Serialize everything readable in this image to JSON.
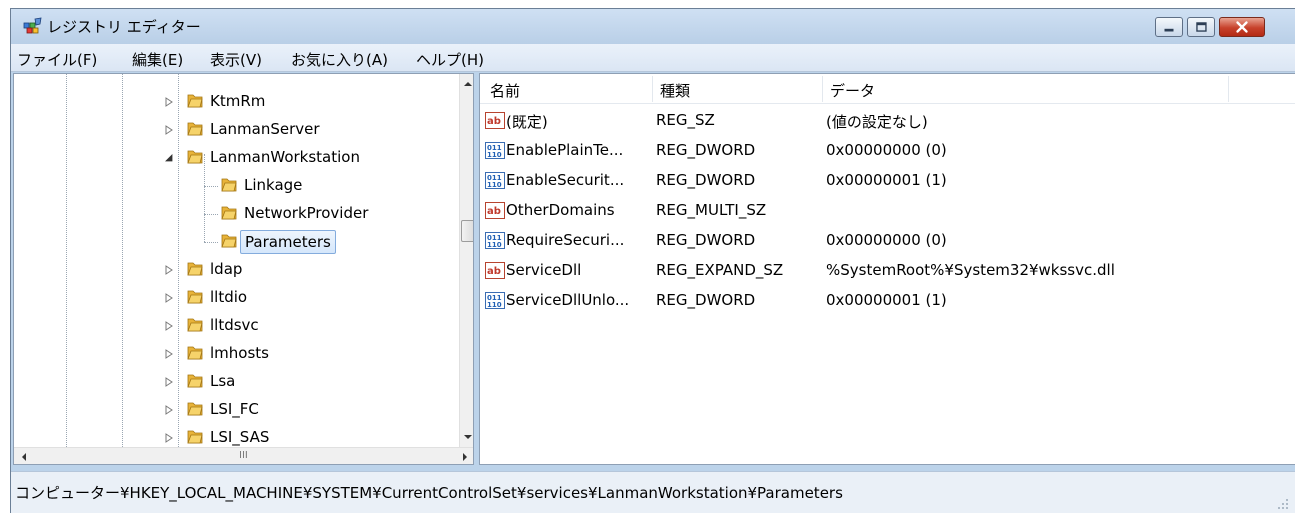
{
  "window": {
    "title": "レジストリ エディター"
  },
  "menu": {
    "items": [
      {
        "label": "ファイル(F)"
      },
      {
        "label": "編集(E)"
      },
      {
        "label": "表示(V)"
      },
      {
        "label": "お気に入り(A)"
      },
      {
        "label": "ヘルプ(H)"
      }
    ]
  },
  "tree": {
    "nodes": [
      {
        "label": "KtmRm",
        "expander": "collapsed",
        "icon": "folder-icon"
      },
      {
        "label": "LanmanServer",
        "expander": "collapsed",
        "icon": "folder-icon"
      },
      {
        "label": "LanmanWorkstation",
        "expander": "expanded",
        "icon": "folder-icon"
      },
      {
        "label": "Linkage",
        "expander": "none",
        "icon": "folder-icon"
      },
      {
        "label": "NetworkProvider",
        "expander": "none",
        "icon": "folder-icon"
      },
      {
        "label": "Parameters",
        "expander": "none",
        "icon": "folder-icon",
        "selected": true
      },
      {
        "label": "ldap",
        "expander": "collapsed",
        "icon": "folder-icon"
      },
      {
        "label": "lltdio",
        "expander": "collapsed",
        "icon": "folder-icon"
      },
      {
        "label": "lltdsvc",
        "expander": "collapsed",
        "icon": "folder-icon"
      },
      {
        "label": "lmhosts",
        "expander": "collapsed",
        "icon": "folder-icon"
      },
      {
        "label": "Lsa",
        "expander": "collapsed",
        "icon": "folder-icon"
      },
      {
        "label": "LSI_FC",
        "expander": "collapsed",
        "icon": "folder-icon"
      },
      {
        "label": "LSI_SAS",
        "expander": "collapsed",
        "icon": "folder-icon"
      }
    ],
    "hscroll_glyph": "III"
  },
  "list": {
    "columns": [
      {
        "label": "名前"
      },
      {
        "label": "種類"
      },
      {
        "label": "データ"
      }
    ],
    "rows": [
      {
        "icon": "string-value-icon",
        "name": "(既定)",
        "type": "REG_SZ",
        "data": "(値の設定なし)"
      },
      {
        "icon": "binary-value-icon",
        "name": "EnablePlainTe...",
        "type": "REG_DWORD",
        "data": "0x00000000 (0)"
      },
      {
        "icon": "binary-value-icon",
        "name": "EnableSecurit...",
        "type": "REG_DWORD",
        "data": "0x00000001 (1)"
      },
      {
        "icon": "string-value-icon",
        "name": "OtherDomains",
        "type": "REG_MULTI_SZ",
        "data": ""
      },
      {
        "icon": "binary-value-icon",
        "name": "RequireSecuri...",
        "type": "REG_DWORD",
        "data": "0x00000000 (0)"
      },
      {
        "icon": "string-value-icon",
        "name": "ServiceDll",
        "type": "REG_EXPAND_SZ",
        "data": "%SystemRoot%¥System32¥wkssvc.dll"
      },
      {
        "icon": "binary-value-icon",
        "name": "ServiceDllUnlo...",
        "type": "REG_DWORD",
        "data": "0x00000001 (1)"
      }
    ]
  },
  "status": {
    "path": "コンピューター¥HKEY_LOCAL_MACHINE¥SYSTEM¥CurrentControlSet¥services¥LanmanWorkstation¥Parameters"
  },
  "colors": {
    "frame": "#bcd3ea",
    "selection": "#d5e7fb",
    "close_button": "#c7412b",
    "folder": "#e8b339"
  }
}
